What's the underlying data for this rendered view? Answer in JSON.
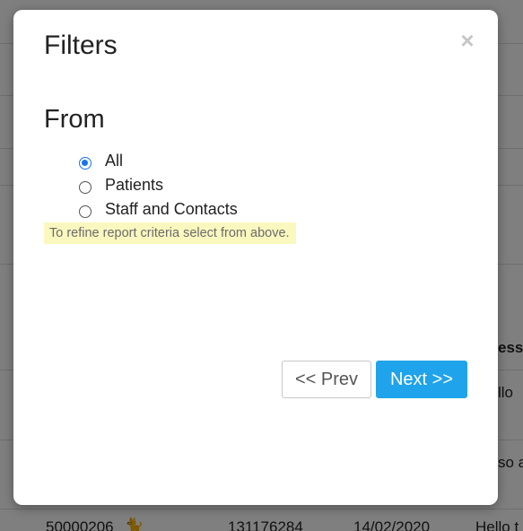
{
  "background": {
    "header_partial": "essa",
    "row1_partial": "llo",
    "row2_partial": "so a",
    "row3": {
      "id": "50000206",
      "number": "131176284",
      "date": "14/02/2020",
      "message_partial": "Hello t"
    }
  },
  "modal": {
    "title": "Filters",
    "close_symbol": "×",
    "section_title": "From",
    "radio_options": [
      {
        "label": "All",
        "checked": true
      },
      {
        "label": "Patients",
        "checked": false
      },
      {
        "label": "Staff and Contacts",
        "checked": false
      }
    ],
    "hint": "To refine report criteria select from above.",
    "prev_label": "<< Prev",
    "next_label": "Next >>"
  },
  "colors": {
    "primary": "#1fa3ea",
    "radio_checked": "#1a73e8",
    "hint_background": "#fbf8bf"
  }
}
